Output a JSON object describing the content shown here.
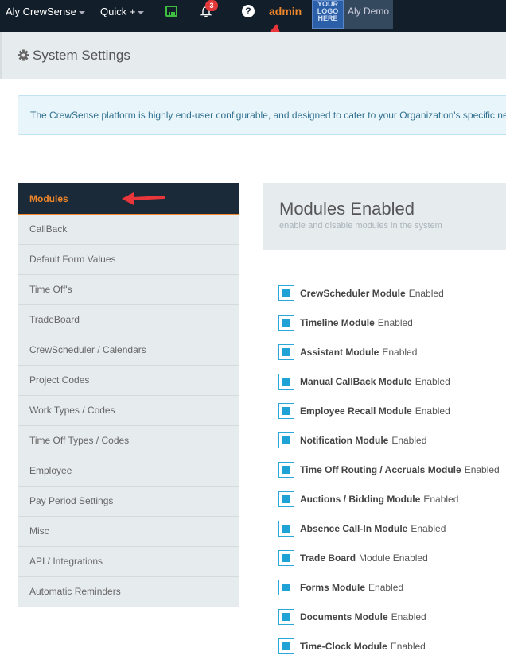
{
  "navbar": {
    "brand": "Aly CrewSense",
    "quick": "Quick +",
    "notification_count": "3",
    "help": "?",
    "admin": "admin",
    "logo_text": [
      "YOUR",
      "LOGO",
      "HERE"
    ],
    "user": "Aly Demo"
  },
  "page": {
    "title": "System Settings",
    "banner": "The CrewSense platform is highly end-user configurable, and designed to cater to your Organization's specific needs."
  },
  "sidebar": {
    "items": [
      {
        "label": "Modules",
        "active": true
      },
      {
        "label": "CallBack"
      },
      {
        "label": "Default Form Values"
      },
      {
        "label": "Time Off's"
      },
      {
        "label": "TradeBoard"
      },
      {
        "label": "CrewScheduler / Calendars"
      },
      {
        "label": "Project Codes"
      },
      {
        "label": "Work Types / Codes"
      },
      {
        "label": "Time Off Types / Codes"
      },
      {
        "label": "Employee"
      },
      {
        "label": "Pay Period Settings"
      },
      {
        "label": "Misc"
      },
      {
        "label": "API / Integrations"
      },
      {
        "label": "Automatic Reminders"
      }
    ]
  },
  "panel": {
    "title": "Modules Enabled",
    "subtitle": "enable and disable modules in the system",
    "modules": [
      {
        "name": "CrewScheduler Module",
        "state": "Enabled"
      },
      {
        "name": "Timeline Module",
        "state": "Enabled"
      },
      {
        "name": "Assistant Module",
        "state": "Enabled"
      },
      {
        "name": "Manual CallBack Module",
        "state": "Enabled"
      },
      {
        "name": "Employee Recall Module",
        "state": "Enabled"
      },
      {
        "name": "Notification Module",
        "state": "Enabled"
      },
      {
        "name": "Time Off Routing / Accruals Module",
        "state": "Enabled"
      },
      {
        "name": "Auctions / Bidding Module",
        "state": "Enabled"
      },
      {
        "name": "Absence Call-In Module",
        "state": "Enabled"
      },
      {
        "name": "Trade Board",
        "state": "Module Enabled"
      },
      {
        "name": "Forms Module",
        "state": "Enabled"
      },
      {
        "name": "Documents Module",
        "state": "Enabled"
      },
      {
        "name": "Time-Clock Module",
        "state": "Enabled"
      }
    ]
  },
  "colors": {
    "navbar_bg": "#121e29",
    "accent_orange": "#f0862a",
    "checkbox_blue": "#1fa2d6",
    "arrow_red": "#e8363b"
  },
  "icons": [
    "calendar-icon",
    "bell-icon",
    "help-icon",
    "gear-icon",
    "checkbox-icon",
    "caret-down-icon"
  ]
}
